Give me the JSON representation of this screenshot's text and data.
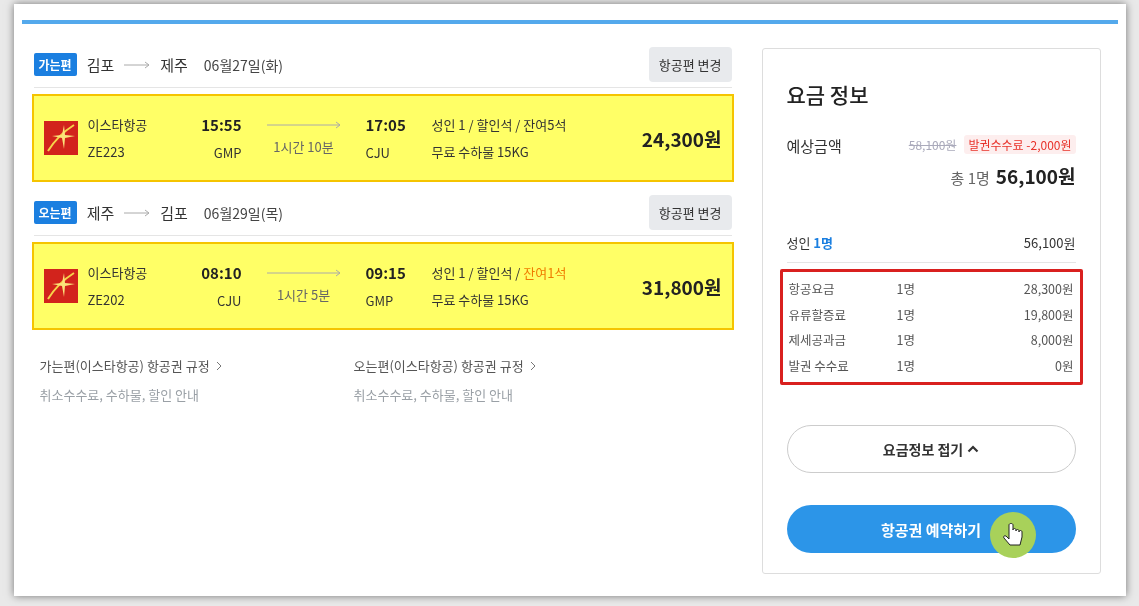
{
  "segments": [
    {
      "badge": "가는편",
      "from": "김포",
      "to": "제주",
      "date": "06월27일(화)",
      "change_button": "항공편 변경",
      "flight": {
        "highlighted": true,
        "airline": "이스타항공",
        "code": "ZE223",
        "depart_time": "15:55",
        "depart_airport": "GMP",
        "duration": "1시간 10분",
        "arrive_time": "17:05",
        "arrive_airport": "CJU",
        "fare": "성인 1 / 할인석 /",
        "remaining": "잔여5석",
        "low_seats": false,
        "baggage": "무료 수하물 15KG",
        "price": "24,300원"
      }
    },
    {
      "badge": "오는편",
      "from": "제주",
      "to": "김포",
      "date": "06월29일(목)",
      "change_button": "항공편 변경",
      "flight": {
        "highlighted": true,
        "airline": "이스타항공",
        "code": "ZE202",
        "depart_time": "08:10",
        "depart_airport": "CJU",
        "duration": "1시간 5분",
        "arrive_time": "09:15",
        "arrive_airport": "GMP",
        "fare": "성인 1 / 할인석 /",
        "remaining": "잔여1석",
        "low_seats": true,
        "baggage": "무료 수하물 15KG",
        "price": "31,800원"
      }
    }
  ],
  "rules": [
    {
      "link": "가는편(이스타항공) 항공권 규정",
      "note": "취소수수료, 수하물, 할인 안내"
    },
    {
      "link": "오는편(이스타항공) 항공권 규정",
      "note": "취소수수료, 수하물, 할인 안내"
    }
  ],
  "fare_panel": {
    "title": "요금 정보",
    "estimate_label": "예상금액",
    "original_price": "58,100원",
    "discount_badge": "발권수수료 -2,000원",
    "total_prefix": "총 1명",
    "total": "56,100원",
    "adult_label": "성인",
    "adult_count": "1명",
    "adult_amount": "56,100원",
    "breakdown_highlighted": true,
    "breakdown": [
      {
        "label": "항공요금",
        "count": "1명",
        "amount": "28,300원"
      },
      {
        "label": "유류할증료",
        "count": "1명",
        "amount": "19,800원"
      },
      {
        "label": "제세공과금",
        "count": "1명",
        "amount": "8,000원"
      },
      {
        "label": "발권 수수료",
        "count": "1명",
        "amount": "0원"
      }
    ],
    "collapse_button": "요금정보 접기",
    "book_button": "항공권 예약하기"
  }
}
